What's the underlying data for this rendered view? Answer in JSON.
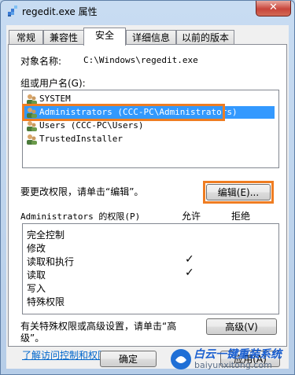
{
  "window": {
    "title": "regedit.exe 属性",
    "close_label": "✕"
  },
  "tabs": [
    {
      "label": "常规"
    },
    {
      "label": "兼容性"
    },
    {
      "label": "安全"
    },
    {
      "label": "详细信息"
    },
    {
      "label": "以前的版本"
    }
  ],
  "security": {
    "object_label": "对象名称:",
    "object_value": "C:\\Windows\\regedit.exe",
    "groups_label": "组或用户名(G):",
    "users": [
      {
        "name": "SYSTEM"
      },
      {
        "name": "Administrators (CCC-PC\\Administrators)"
      },
      {
        "name": "Users (CCC-PC\\Users)"
      },
      {
        "name": "TrustedInstaller"
      }
    ],
    "selected_user_index": 1,
    "change_text": "要更改权限，请单击“编辑”。",
    "edit_button": "编辑(E)...",
    "perm_header": "Administrators 的权限(P)",
    "allow_header": "允许",
    "deny_header": "拒绝",
    "permissions": [
      {
        "name": "完全控制",
        "allow": ""
      },
      {
        "name": "修改",
        "allow": ""
      },
      {
        "name": "读取和执行",
        "allow": "✓"
      },
      {
        "name": "读取",
        "allow": "✓"
      },
      {
        "name": "写入",
        "allow": ""
      },
      {
        "name": "特殊权限",
        "allow": ""
      }
    ],
    "advanced_text_line1": "有关特殊权限或高级设置，请单击“高",
    "advanced_text_line2": "级”。",
    "advanced_button": "高级(V)",
    "learn_link": "了解访问控制和权限"
  },
  "footer": {
    "ok_button": "确定",
    "apply_button": "应用(A)"
  },
  "watermark": {
    "text": "白云一键重装系统",
    "url": "baiyunxitong.com"
  },
  "colors": {
    "highlight": "#ef7d22",
    "selection": "#3399ff",
    "link": "#0066cc"
  }
}
